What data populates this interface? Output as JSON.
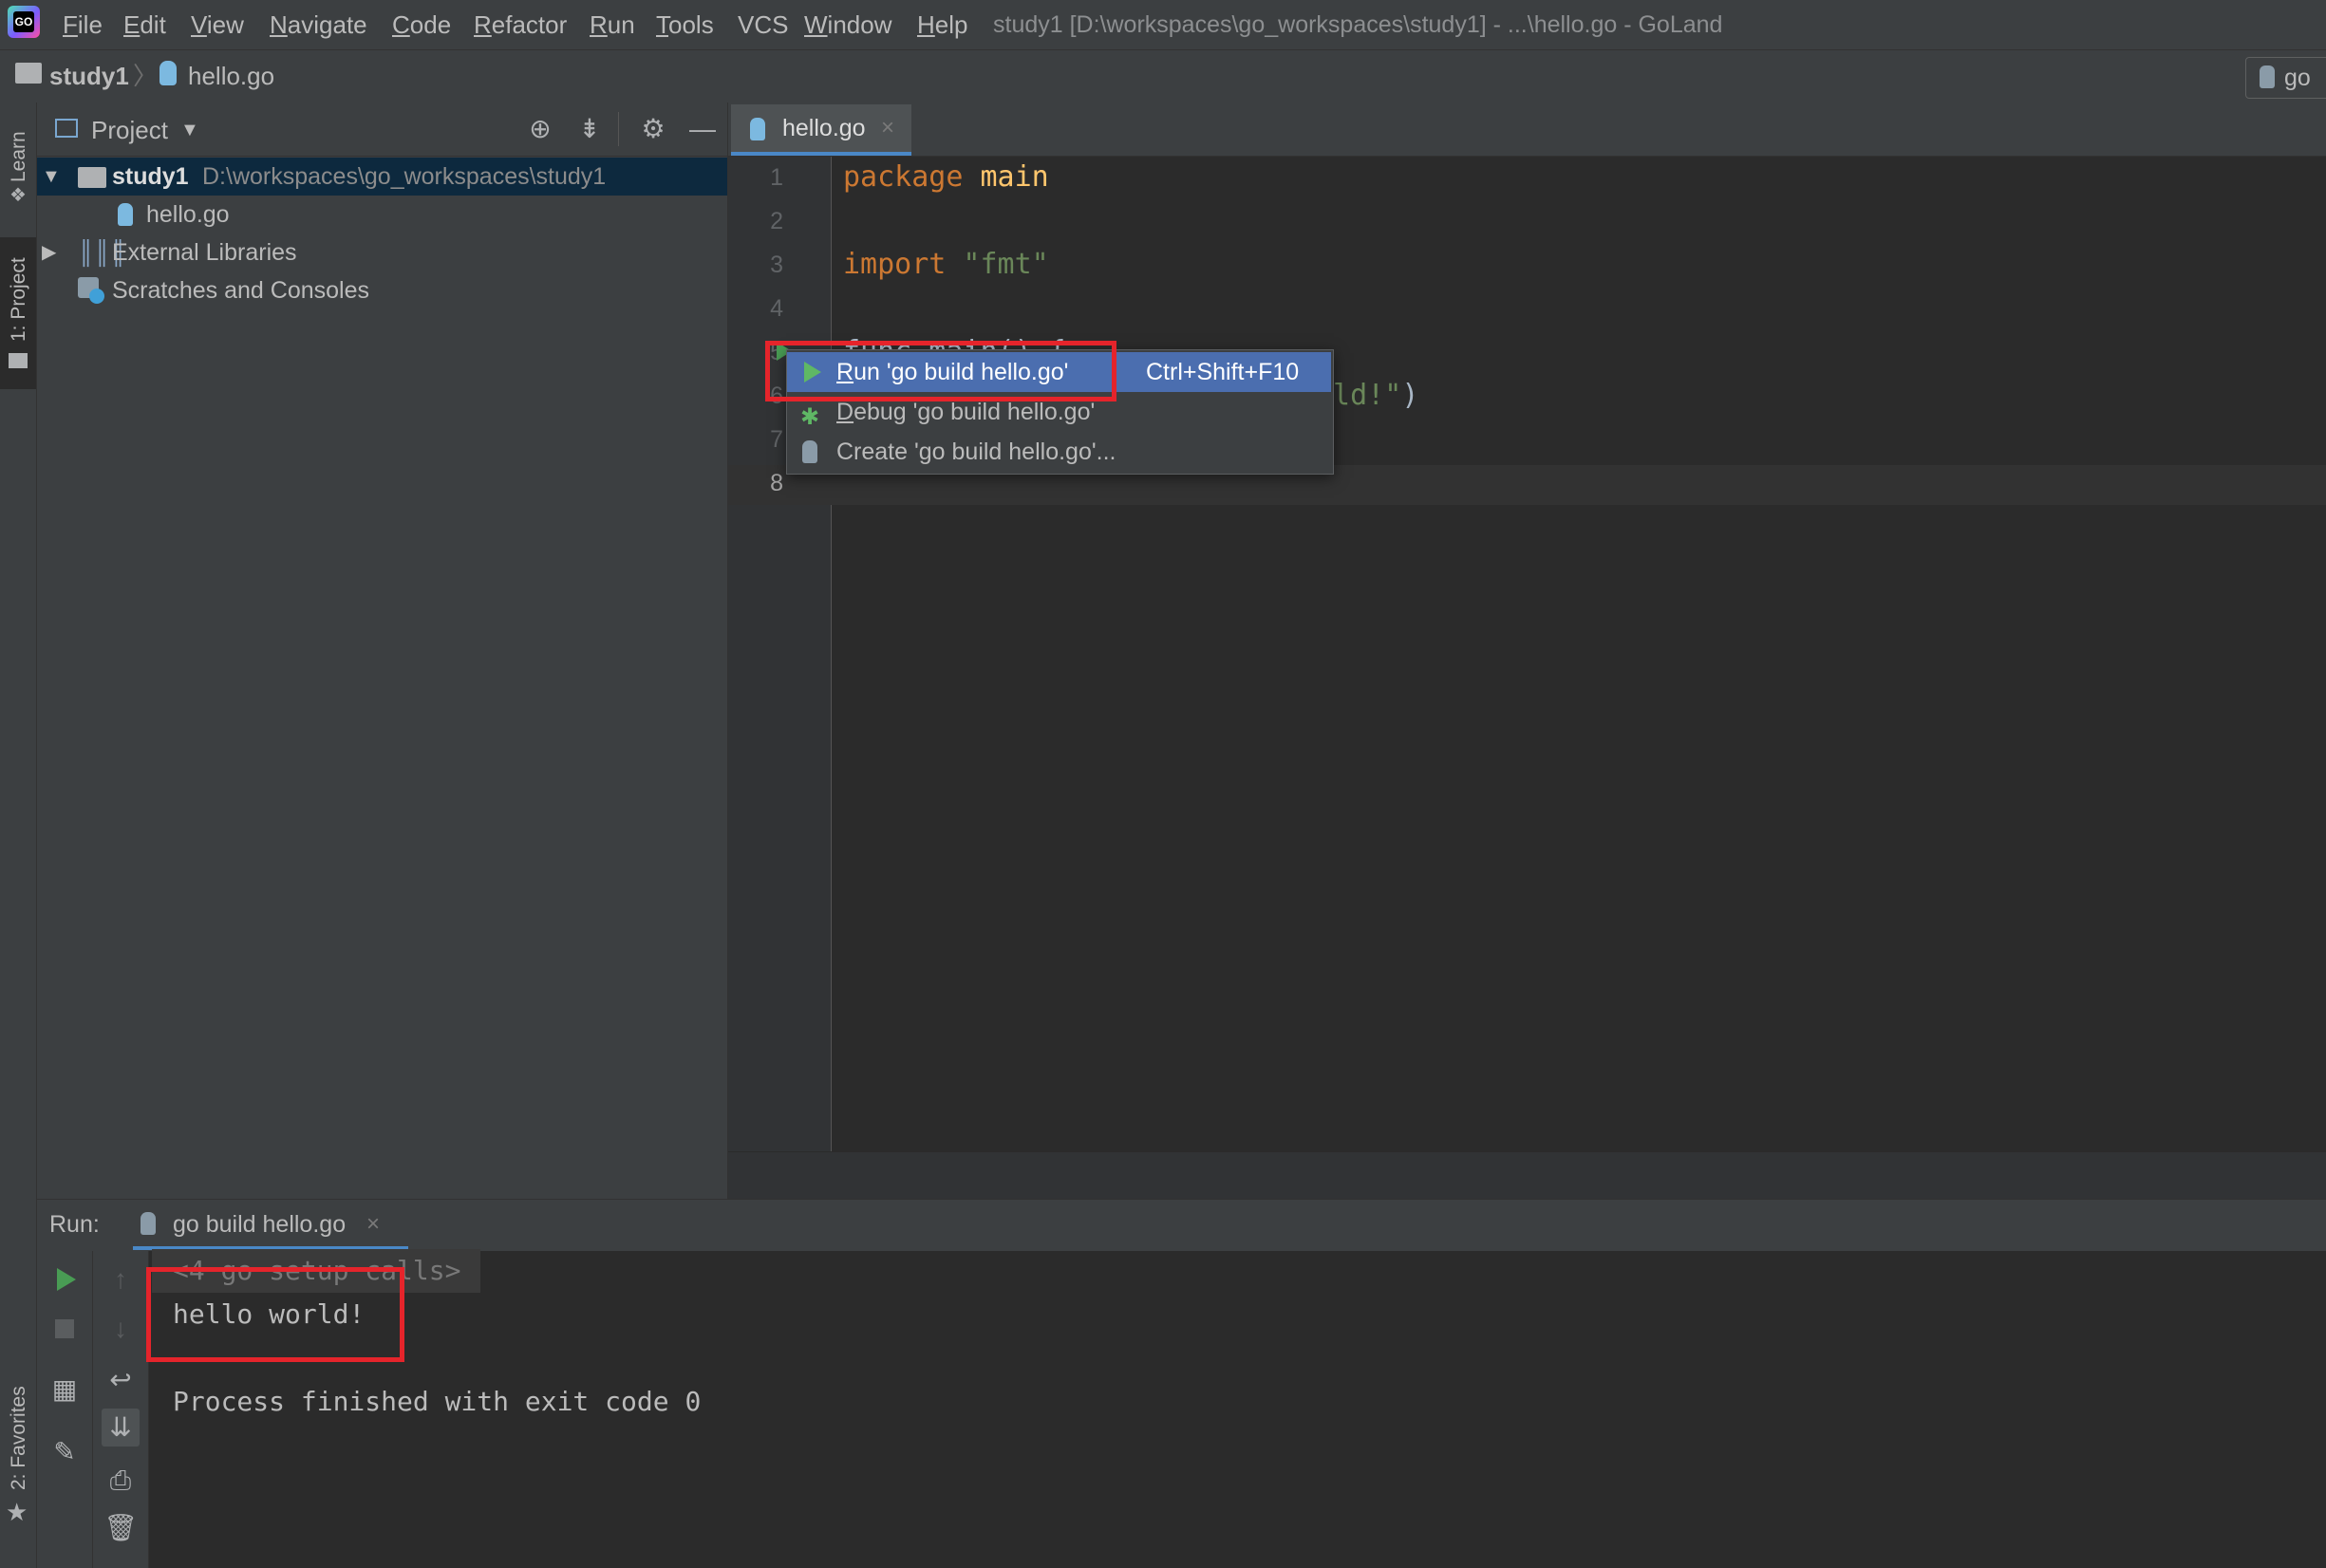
{
  "window": {
    "title": "study1 [D:\\workspaces\\go_workspaces\\study1] - ...\\hello.go - GoLand",
    "logo_text": "GO"
  },
  "menu": [
    {
      "mnemonic": "F",
      "rest": "ile"
    },
    {
      "mnemonic": "E",
      "rest": "dit"
    },
    {
      "mnemonic": "V",
      "rest": "iew"
    },
    {
      "mnemonic": "N",
      "rest": "avigate"
    },
    {
      "mnemonic": "C",
      "rest": "ode"
    },
    {
      "mnemonic": "R",
      "rest": "efactor"
    },
    {
      "mnemonic": "R",
      "rest": "un"
    },
    {
      "mnemonic": "T",
      "rest": "ools"
    },
    {
      "mnemonic": "",
      "rest": "VCS"
    },
    {
      "mnemonic": "W",
      "rest": "indow"
    },
    {
      "mnemonic": "H",
      "rest": "elp"
    }
  ],
  "breadcrumb": {
    "project": "study1",
    "file": "hello.go",
    "run_config": "go"
  },
  "side_tabs": {
    "learn": "Learn",
    "project": "1: Project",
    "favorites": "2: Favorites"
  },
  "project_panel": {
    "title": "Project",
    "tree": [
      {
        "name": "study1",
        "path": "D:\\workspaces\\go_workspaces\\study1",
        "expanded": true,
        "selected": true
      },
      {
        "name": "hello.go"
      },
      {
        "name": "External Libraries",
        "expanded": false
      },
      {
        "name": "Scratches and Consoles"
      }
    ]
  },
  "editor": {
    "tab_label": "hello.go",
    "line_numbers": [
      "1",
      "2",
      "3",
      "4",
      "5",
      "6",
      "7",
      "8"
    ],
    "code": {
      "l1_kw": "package",
      "l1_rest": " main",
      "l3_kw": "import",
      "l3_str": " \"fmt\"",
      "l5_partial": "func main() {",
      "l6_partial_str": "rld!\"",
      "l6_partial_end": ")"
    }
  },
  "popup_menu": {
    "items": [
      {
        "mnemonic": "R",
        "rest": "un 'go build hello.go'",
        "shortcut": "Ctrl+Shift+F10",
        "selected": true
      },
      {
        "mnemonic": "D",
        "rest": "ebug 'go build hello.go'",
        "shortcut": ""
      },
      {
        "mnemonic": "",
        "rest": "Create 'go build hello.go'...",
        "shortcut": ""
      }
    ]
  },
  "run_panel": {
    "label": "Run:",
    "tab_label": "go build hello.go",
    "console": {
      "collapsed": "<4 go setup calls>",
      "output": "hello world!",
      "exit": "Process finished with exit code 0"
    }
  },
  "colors": {
    "highlight_box": "#e5242b",
    "selection": "#4b6eaf",
    "run_green": "#499c54"
  }
}
